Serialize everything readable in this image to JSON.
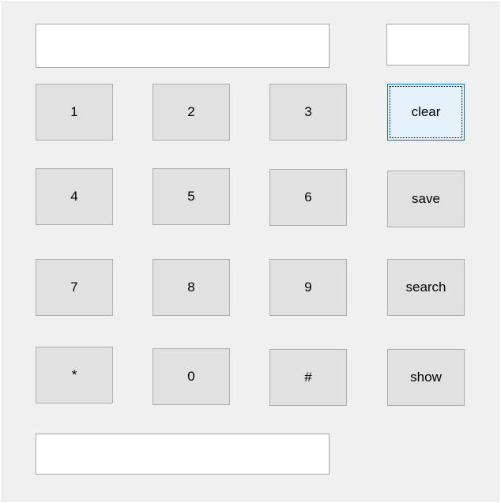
{
  "display": {
    "main_value": "",
    "side_value": "",
    "result_value": ""
  },
  "keypad": [
    {
      "label": "1"
    },
    {
      "label": "2"
    },
    {
      "label": "3"
    },
    {
      "label": "4"
    },
    {
      "label": "5"
    },
    {
      "label": "6"
    },
    {
      "label": "7"
    },
    {
      "label": "8"
    },
    {
      "label": "9"
    },
    {
      "label": "*"
    },
    {
      "label": "0"
    },
    {
      "label": "#"
    }
  ],
  "actions": {
    "clear_label": "clear",
    "save_label": "save",
    "search_label": "search",
    "show_label": "show"
  },
  "colors": {
    "window_background": "#f0f0f0",
    "button_face": "#e1e1e1",
    "button_border": "#adadad",
    "focus_background": "#e5f1fb",
    "focus_border": "#0078d7"
  },
  "focused_control": "clear"
}
